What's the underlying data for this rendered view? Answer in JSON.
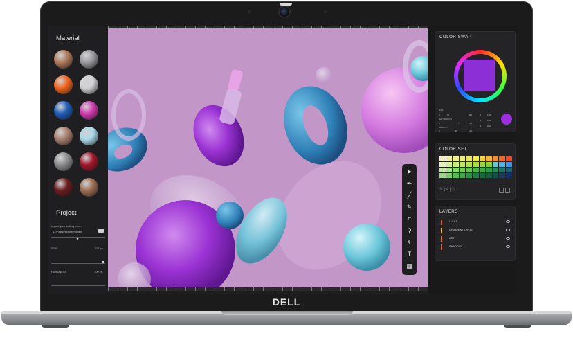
{
  "device": {
    "logo": "DELL"
  },
  "left_panel": {
    "material_title": "Material",
    "material_swatches": [
      {
        "name": "copper-sphere",
        "color": "#b07a5c"
      },
      {
        "name": "chrome-sphere",
        "color": "#9b9ba0"
      },
      {
        "name": "orange-sphere",
        "color": "#f2651e"
      },
      {
        "name": "white-sphere",
        "color": "#d2d2d6"
      },
      {
        "name": "blue-sphere",
        "color": "#1f5db8"
      },
      {
        "name": "pink-sphere",
        "color": "#d33bb0"
      },
      {
        "name": "bronze-sphere",
        "color": "#a8806f"
      },
      {
        "name": "glass-sphere",
        "color": "#aad9e8"
      },
      {
        "name": "marble-sphere",
        "color": "#8d8d8f"
      },
      {
        "name": "red-sphere",
        "color": "#a3162a"
      },
      {
        "name": "burgundy-sphere",
        "color": "#6b1d1d"
      },
      {
        "name": "tan-sphere",
        "color": "#9d6e54"
      }
    ],
    "project_title": "Project",
    "import_label": "Import your setting from...",
    "import_path": "D:\\Fabdesignr\\template",
    "size_label": "SIZE",
    "size_value": "112 px",
    "hardness_label": "HARDNESS",
    "hardness_value": "100 %"
  },
  "toolbar": {
    "tools": [
      {
        "name": "select-arrow-tool",
        "glyph": "➤"
      },
      {
        "name": "pen-tool",
        "glyph": "✒"
      },
      {
        "name": "brush-tool",
        "glyph": "╱"
      },
      {
        "name": "pencil-tool",
        "glyph": "✎"
      },
      {
        "name": "crop-tool",
        "glyph": "⌗"
      },
      {
        "name": "zoom-tool",
        "glyph": "⚲"
      },
      {
        "name": "eyedropper-tool",
        "glyph": "⚕"
      },
      {
        "name": "text-tool",
        "glyph": "T"
      },
      {
        "name": "gradient-tool",
        "glyph": "▦"
      }
    ]
  },
  "right_panel": {
    "color_swap_title": "COLOR SWAP",
    "color_values": {
      "hue_label": "HUE",
      "hue_min": "0",
      "hue_mid": "27",
      "hue_max": "360",
      "sat_label": "SATURATION",
      "sat_min": "0",
      "sat_mid": "71",
      "sat_max": "100",
      "opacity_label": "OPACITY",
      "opacity_min": "0",
      "opacity_mid": "90",
      "opacity_max": "100",
      "r_label": "R",
      "r_value": "118",
      "g_label": "G",
      "g_value": "196",
      "b_label": "B",
      "b_value": "200"
    },
    "selected_color": "#8c2fd6",
    "color_set_title": "COLOR SET",
    "palette_rows": [
      [
        "#f3f0c0",
        "#f2f0a8",
        "#f0ef8a",
        "#eef07a",
        "#eae85a",
        "#f3e64a",
        "#f3d43a",
        "#f2b43a",
        "#f08f2f",
        "#ef6a2b",
        "#ec4b2a"
      ],
      [
        "#e2efb6",
        "#d6ee9a",
        "#c9ec7c",
        "#bde75f",
        "#b1e245",
        "#a7db3a",
        "#9ad23a",
        "#8fcb3a",
        "#6fc3d6",
        "#55b0e3",
        "#3b95e6"
      ],
      [
        "#c4e8a2",
        "#a6df84",
        "#8bd66a",
        "#70cd52",
        "#5bc44a",
        "#48bb47",
        "#3aad49",
        "#2f9f4d",
        "#248d57",
        "#1f7563",
        "#1b5f72"
      ],
      [
        "#9ed487",
        "#7fc76d",
        "#5eb757",
        "#45a74d",
        "#2f9446",
        "#1e8042",
        "#1a6a3f",
        "#1b5a3f",
        "#1b4b4a",
        "#1a3c5a",
        "#182e6a"
      ]
    ],
    "layers_title": "LAYERS",
    "layers": [
      {
        "name": "LIGHT",
        "color": "#e4572e"
      },
      {
        "name": "GRADIENT LAYER",
        "color": "#f2b01e"
      },
      {
        "name": "ART",
        "color": "#f06a2b"
      },
      {
        "name": "SHADOW",
        "color": "#e8612d"
      }
    ]
  }
}
